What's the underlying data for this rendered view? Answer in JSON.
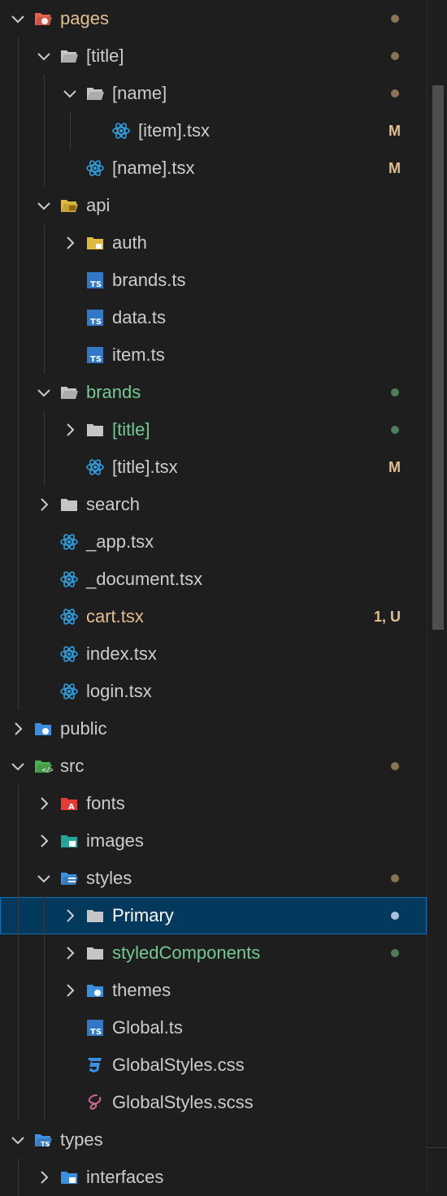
{
  "colors": {
    "background": "#1e1e1e",
    "selected_bg": "#04395e",
    "selected_border": "#0e71b8",
    "modified": "#e2c08d",
    "added": "#73c991",
    "dot_modified": "#8a7454",
    "dot_added": "#4d7d5c",
    "dot_selected": "#a8c1d8",
    "react_icon": "#2f9fe0",
    "ts_icon": "#3178c6"
  },
  "tree": {
    "items": [
      {
        "label": "pages",
        "depth": 0,
        "kind": "folder-open",
        "icon": "pages-folder-icon",
        "status": "modified",
        "decoration": "",
        "dot": "orange"
      },
      {
        "label": "[title]",
        "depth": 1,
        "kind": "folder-open",
        "icon": "folder-open-icon",
        "status": "",
        "decoration": "",
        "dot": "gray"
      },
      {
        "label": "[name]",
        "depth": 2,
        "kind": "folder-open",
        "icon": "folder-open-icon",
        "status": "",
        "decoration": "",
        "dot": "gray"
      },
      {
        "label": "[item].tsx",
        "depth": 3,
        "kind": "file",
        "icon": "react-icon",
        "status": "",
        "decoration": "M",
        "dot": ""
      },
      {
        "label": "[name].tsx",
        "depth": 2,
        "kind": "file",
        "icon": "react-icon",
        "status": "",
        "decoration": "M",
        "dot": ""
      },
      {
        "label": "api",
        "depth": 1,
        "kind": "folder-open",
        "icon": "api-folder-icon",
        "status": "",
        "decoration": "",
        "dot": ""
      },
      {
        "label": "auth",
        "depth": 2,
        "kind": "folder-closed",
        "icon": "auth-folder-icon",
        "status": "",
        "decoration": "",
        "dot": ""
      },
      {
        "label": "brands.ts",
        "depth": 2,
        "kind": "file",
        "icon": "ts-icon",
        "status": "",
        "decoration": "",
        "dot": ""
      },
      {
        "label": "data.ts",
        "depth": 2,
        "kind": "file",
        "icon": "ts-icon",
        "status": "",
        "decoration": "",
        "dot": ""
      },
      {
        "label": "item.ts",
        "depth": 2,
        "kind": "file",
        "icon": "ts-icon",
        "status": "",
        "decoration": "",
        "dot": ""
      },
      {
        "label": "brands",
        "depth": 1,
        "kind": "folder-open",
        "icon": "folder-open-icon",
        "status": "added",
        "decoration": "",
        "dot": "green"
      },
      {
        "label": "[title]",
        "depth": 2,
        "kind": "folder-closed",
        "icon": "folder-icon",
        "status": "added",
        "decoration": "",
        "dot": "green"
      },
      {
        "label": "[title].tsx",
        "depth": 2,
        "kind": "file",
        "icon": "react-icon",
        "status": "",
        "decoration": "M",
        "dot": ""
      },
      {
        "label": "search",
        "depth": 1,
        "kind": "folder-closed",
        "icon": "folder-icon",
        "status": "",
        "decoration": "",
        "dot": ""
      },
      {
        "label": "_app.tsx",
        "depth": 1,
        "kind": "file",
        "icon": "react-icon",
        "status": "",
        "decoration": "",
        "dot": ""
      },
      {
        "label": "_document.tsx",
        "depth": 1,
        "kind": "file",
        "icon": "react-icon",
        "status": "",
        "decoration": "",
        "dot": ""
      },
      {
        "label": "cart.tsx",
        "depth": 1,
        "kind": "file",
        "icon": "react-icon",
        "status": "modified",
        "decoration": "1, U",
        "dot": ""
      },
      {
        "label": "index.tsx",
        "depth": 1,
        "kind": "file",
        "icon": "react-icon",
        "status": "",
        "decoration": "",
        "dot": ""
      },
      {
        "label": "login.tsx",
        "depth": 1,
        "kind": "file",
        "icon": "react-icon",
        "status": "",
        "decoration": "",
        "dot": ""
      },
      {
        "label": "public",
        "depth": 0,
        "kind": "folder-closed",
        "icon": "public-folder-icon",
        "status": "",
        "decoration": "",
        "dot": ""
      },
      {
        "label": "src",
        "depth": 0,
        "kind": "folder-open",
        "icon": "src-folder-icon",
        "status": "",
        "decoration": "",
        "dot": "gray"
      },
      {
        "label": "fonts",
        "depth": 1,
        "kind": "folder-closed",
        "icon": "fonts-folder-icon",
        "status": "",
        "decoration": "",
        "dot": ""
      },
      {
        "label": "images",
        "depth": 1,
        "kind": "folder-closed",
        "icon": "images-folder-icon",
        "status": "",
        "decoration": "",
        "dot": ""
      },
      {
        "label": "styles",
        "depth": 1,
        "kind": "folder-open",
        "icon": "styles-folder-icon",
        "status": "",
        "decoration": "",
        "dot": "gray"
      },
      {
        "label": "Primary",
        "depth": 2,
        "kind": "folder-closed",
        "icon": "folder-icon",
        "status": "",
        "decoration": "",
        "dot": "selected",
        "selected": true
      },
      {
        "label": "styledComponents",
        "depth": 2,
        "kind": "folder-closed",
        "icon": "folder-icon",
        "status": "added",
        "decoration": "",
        "dot": "green"
      },
      {
        "label": "themes",
        "depth": 2,
        "kind": "folder-closed",
        "icon": "themes-folder-icon",
        "status": "",
        "decoration": "",
        "dot": ""
      },
      {
        "label": "Global.ts",
        "depth": 2,
        "kind": "file",
        "icon": "ts-icon",
        "status": "",
        "decoration": "",
        "dot": ""
      },
      {
        "label": "GlobalStyles.css",
        "depth": 2,
        "kind": "file",
        "icon": "css-icon",
        "status": "",
        "decoration": "",
        "dot": ""
      },
      {
        "label": "GlobalStyles.scss",
        "depth": 2,
        "kind": "file",
        "icon": "sass-icon",
        "status": "",
        "decoration": "",
        "dot": ""
      },
      {
        "label": "types",
        "depth": 0,
        "kind": "folder-open",
        "icon": "types-folder-icon",
        "status": "",
        "decoration": "",
        "dot": ""
      },
      {
        "label": "interfaces",
        "depth": 1,
        "kind": "folder-closed",
        "icon": "interfaces-folder-icon",
        "status": "",
        "decoration": "",
        "dot": ""
      }
    ]
  }
}
